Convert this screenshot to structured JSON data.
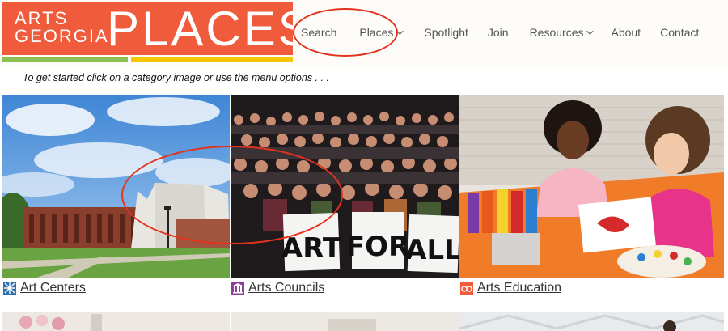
{
  "logo": {
    "line1": "ARTS",
    "line2": "GEORGIA",
    "big": "PLACES"
  },
  "nav": {
    "items": [
      {
        "label": "Search",
        "has_dropdown": false
      },
      {
        "label": "Places",
        "has_dropdown": true
      },
      {
        "label": "Spotlight",
        "has_dropdown": false
      },
      {
        "label": "Join",
        "has_dropdown": false
      },
      {
        "label": "Resources",
        "has_dropdown": true
      },
      {
        "label": "About",
        "has_dropdown": false
      },
      {
        "label": "Contact",
        "has_dropdown": false
      }
    ]
  },
  "intro": "To get started click on a category image or use the menu options . . .",
  "categories": [
    {
      "label": "Art Centers",
      "icon": "art-centers-icon",
      "icon_color": "#2e6fb3"
    },
    {
      "label": "Arts Councils",
      "icon": "arts-councils-icon",
      "icon_color": "#8a3d9a"
    },
    {
      "label": "Arts Education",
      "icon": "arts-education-icon",
      "icon_color": "#ef5b3b"
    }
  ],
  "sign_text": [
    "ART",
    "FOR",
    "ALL"
  ],
  "colors": {
    "brand": "#ef5b3b",
    "green": "#8cc152",
    "yellow": "#f6c700",
    "annotation": "#e3331f"
  }
}
